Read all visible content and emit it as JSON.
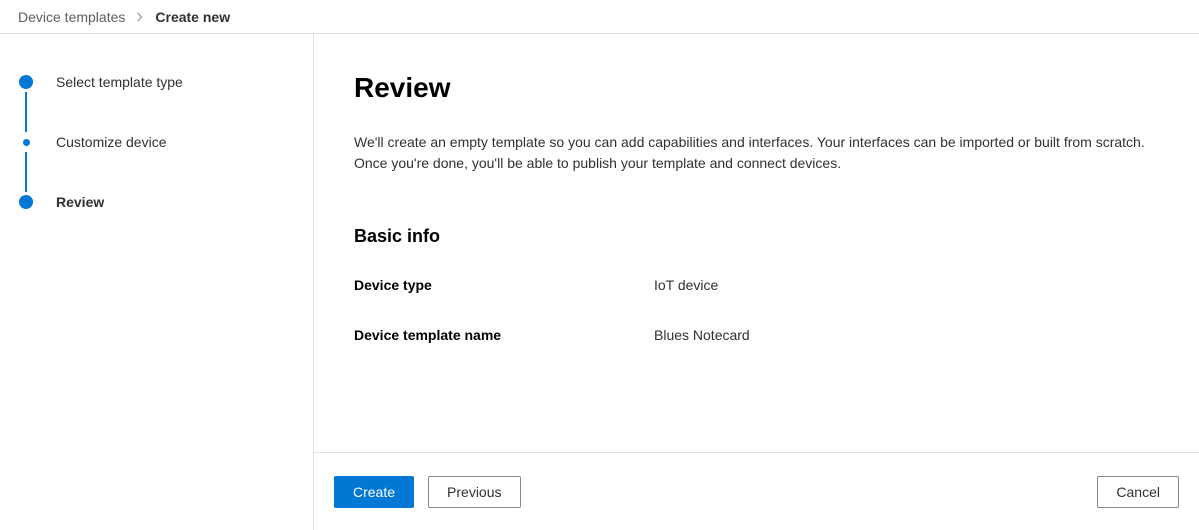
{
  "breadcrumb": {
    "parent": "Device templates",
    "current": "Create new"
  },
  "stepper": {
    "steps": [
      {
        "label": "Select template type"
      },
      {
        "label": "Customize device"
      },
      {
        "label": "Review"
      }
    ]
  },
  "main": {
    "title": "Review",
    "description": "We'll create an empty template so you can add capabilities and interfaces. Your interfaces can be imported or built from scratch. Once you're done, you'll be able to publish your template and connect devices.",
    "basic_info_heading": "Basic info",
    "rows": [
      {
        "label": "Device type",
        "value": "IoT device"
      },
      {
        "label": "Device template name",
        "value": "Blues Notecard"
      }
    ]
  },
  "footer": {
    "create": "Create",
    "previous": "Previous",
    "cancel": "Cancel"
  }
}
